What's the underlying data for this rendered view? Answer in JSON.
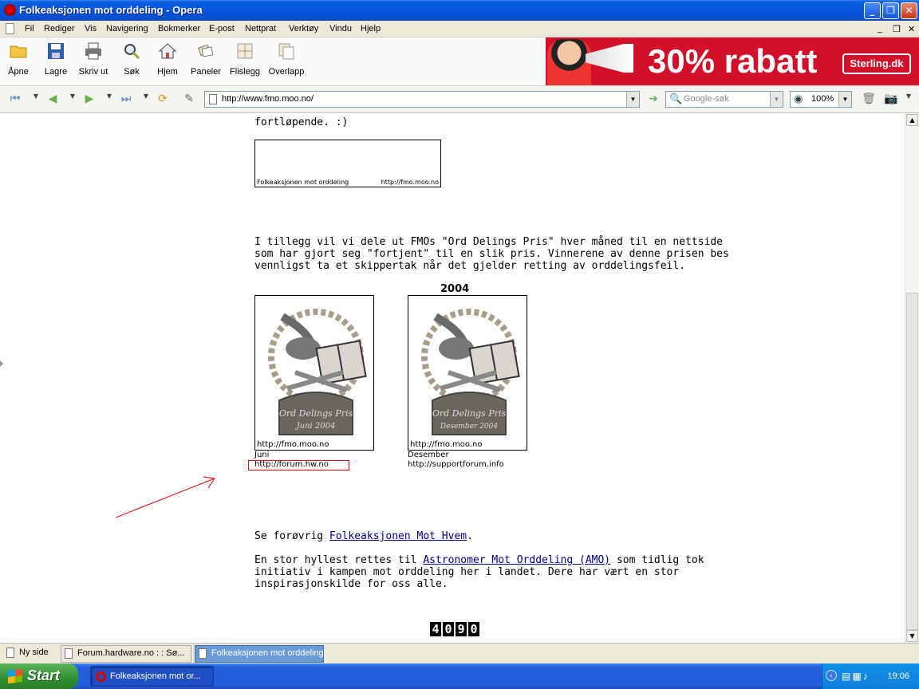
{
  "window": {
    "title": "Folkeaksjonen mot orddeling - Opera"
  },
  "menu": [
    "Fil",
    "Rediger",
    "Vis",
    "Navigering",
    "Bokmerker",
    "E-post",
    "Nettprat",
    "Verktøy",
    "Vindu",
    "Hjelp"
  ],
  "toolbar": {
    "buttons": [
      "Åpne",
      "Lagre",
      "Skriv ut",
      "Søk",
      "Hjem",
      "Paneler",
      "Flislegg",
      "Overlapp"
    ]
  },
  "ad": {
    "text": "30% rabatt",
    "brand": "Sterling.dk"
  },
  "addressbar": {
    "url": "http://www.fmo.moo.no/",
    "search_placeholder": "Google-søk",
    "zoom": "100%"
  },
  "page": {
    "top_line": "fortløpende. :)",
    "banner": {
      "left": "Folkeaksjonen mot orddeling",
      "right": "http://fmo.moo.no"
    },
    "prize_text": [
      "I tillegg vil vi dele ut FMOs \"Ord Delings Pris\" hver måned til en nettside",
      "som har gjort seg \"fortjent\" til en slik pris. Vinnerene av denne prisen bes",
      "vennligst ta et skippertak når det gjelder retting av orddelingsfeil."
    ],
    "year": "2004",
    "awards": [
      {
        "url": "http://fmo.moo.no",
        "month": "Juni",
        "site": "http://forum.hw.no",
        "plaque_l1": "Ord Delings Pris",
        "plaque_l2": "Juni 2004"
      },
      {
        "url": "http://fmo.moo.no",
        "month": "Desember",
        "site": "http://supportforum.info",
        "plaque_l1": "Ord Delings Pris",
        "plaque_l2": "Desember 2004"
      }
    ],
    "see_also_prefix": "Se forøvrig ",
    "see_also_link": "Folkeaksjonen Mot Hvem",
    "see_also_suffix": ".",
    "tribute_prefix": "En stor hyllest rettes til ",
    "tribute_link": "Astronomer Mot Orddeling (AMO)",
    "tribute_line1_suffix": " som tidlig tok",
    "tribute_line2": "initiativ i kampen mot orddeling her i landet. Dere har vært en stor",
    "tribute_line3": "inspirasjonskilde for oss alle.",
    "counter": [
      "4",
      "0",
      "9",
      "0"
    ]
  },
  "tabs": [
    {
      "label": "Ny side"
    },
    {
      "label": "Forum.hardware.no : : Sø..."
    },
    {
      "label": "Folkeaksjonen mot orddeling"
    }
  ],
  "taskbar": {
    "start": "Start",
    "task": "Folkeaksjonen mot or...",
    "time": "19:06"
  }
}
